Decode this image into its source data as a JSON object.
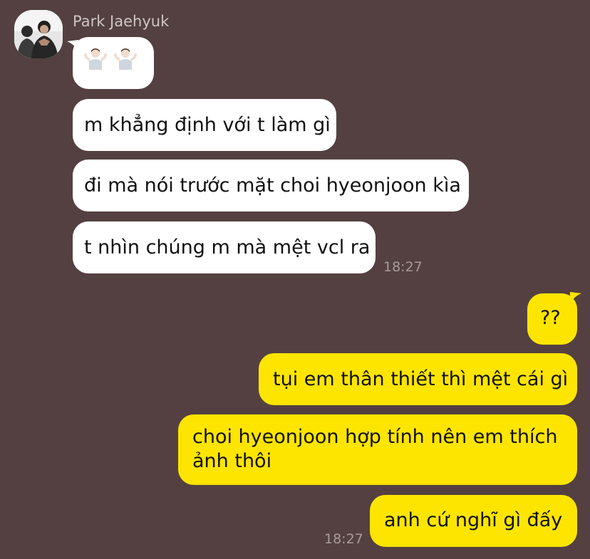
{
  "chat": {
    "sender": {
      "name": "Park Jaehyuk",
      "avatar_icon": "profile-photo-icon"
    },
    "incoming_messages": [
      {
        "type": "emoji",
        "emoji_icon": "person-shrugging-icon",
        "count": 2
      },
      {
        "text": "m khẳng định với t làm gì"
      },
      {
        "text": "đi mà nói trước mặt choi hyeonjoon kìa"
      },
      {
        "text": "t nhìn chúng m mà mệt vcl ra"
      }
    ],
    "incoming_time": "18:27",
    "outgoing_messages": [
      {
        "text": "??"
      },
      {
        "text": "tụi em thân thiết thì mệt cái gì"
      },
      {
        "text": "choi hyeonjoon hợp tính nên em thích ảnh thôi"
      },
      {
        "text": "anh cứ nghĩ gì đấy"
      }
    ],
    "outgoing_time": "18:27"
  },
  "colors": {
    "background": "#544040",
    "incoming_bubble": "#ffffff",
    "outgoing_bubble": "#fee500",
    "timestamp": "#a99a9a",
    "sender_name": "#cfc4c4"
  }
}
